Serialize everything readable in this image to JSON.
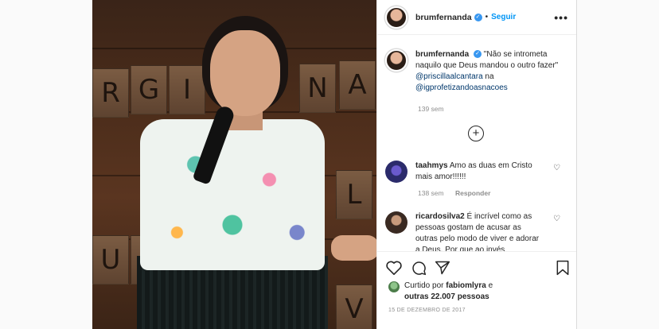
{
  "post": {
    "photo_tiles": [
      "R",
      "G",
      "I",
      "N",
      "A",
      "L",
      "U",
      "T",
      "V"
    ]
  },
  "header": {
    "username": "brumfernanda",
    "dot": "•",
    "follow_label": "Seguir",
    "more_label": "•••"
  },
  "caption": {
    "username": "brumfernanda",
    "text": "\"Não se intrometa naquilo que Deus mandou o outro fazer\"",
    "mention1": "@priscillaalcantara",
    "connector": "na",
    "mention2": "@igprofetizandoasnacoes",
    "time": "139 sem"
  },
  "load_more_label": "+",
  "comments": [
    {
      "username": "taahmys",
      "text": "Amo as duas em Cristo mais amor!!!!!!",
      "time": "138 sem",
      "reply_label": "Responder"
    },
    {
      "username": "ricardosilva2",
      "text": "É incrível como as pessoas gostam de acusar as outras pelo modo de viver e adorar a Deus. Por que ao invés"
    }
  ],
  "likes": {
    "prefix": "Curtido por",
    "user": "fabiomlyra",
    "suffix": "e",
    "others": "outras 22.007 pessoas"
  },
  "date": "15 DE DEZEMBRO DE 2017",
  "colors": {
    "link": "#0095f6",
    "mention": "#00376b",
    "verified": "#3897f0",
    "muted": "#8e8e8e"
  }
}
